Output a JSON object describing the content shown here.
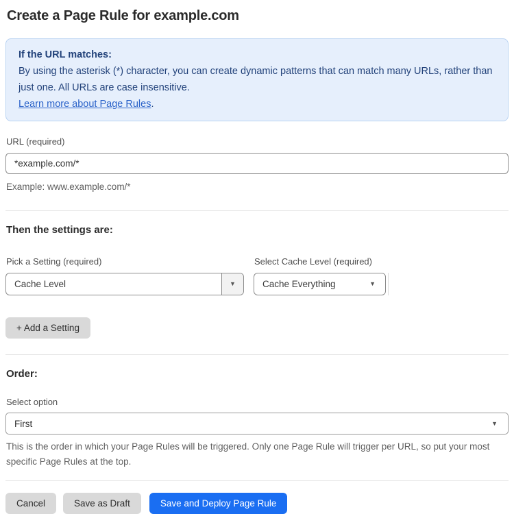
{
  "page": {
    "title": "Create a Page Rule for example.com"
  },
  "info_box": {
    "heading": "If the URL matches:",
    "body": "By using the asterisk (*) character, you can create dynamic patterns that can match many URLs, rather than just one. All URLs are case insensitive.",
    "link_label": "Learn more about Page Rules",
    "link_suffix": "."
  },
  "url_field": {
    "label": "URL (required)",
    "value": "*example.com/*",
    "helper": "Example: www.example.com/*"
  },
  "settings_section": {
    "heading": "Then the settings are:",
    "setting_picker": {
      "label": "Pick a Setting (required)",
      "selected": "Cache Level"
    },
    "cache_level_picker": {
      "label": "Select Cache Level (required)",
      "selected": "Cache Everything"
    },
    "add_setting_label": "+ Add a Setting"
  },
  "order_section": {
    "heading": "Order:",
    "label": "Select option",
    "selected": "First",
    "helper": "This is the order in which your Page Rules will be triggered. Only one Page Rule will trigger per URL, so put your most specific Page Rules at the top."
  },
  "footer": {
    "cancel_label": "Cancel",
    "save_draft_label": "Save as Draft",
    "save_deploy_label": "Save and Deploy Page Rule"
  },
  "icons": {
    "dropdown_arrow": "dropdown-arrow-icon",
    "dropdown_arrow_glyph": "▼"
  },
  "colors": {
    "accent_blue": "#1a6ef2",
    "info_bg": "#e6effc",
    "info_border": "#b9d3f2",
    "info_text": "#22427a",
    "link_blue": "#2a62c9"
  }
}
